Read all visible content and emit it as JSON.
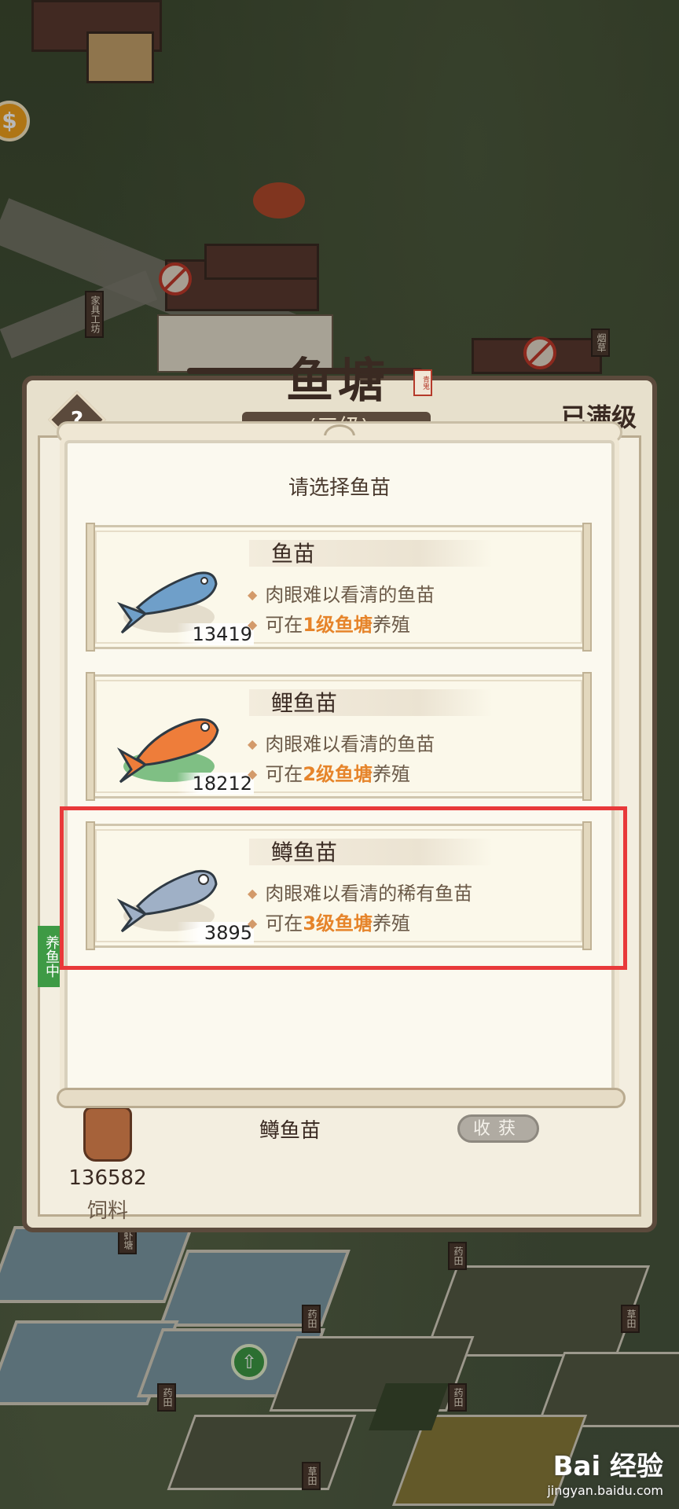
{
  "window": {
    "title": "鱼塘",
    "seal": "青鬼",
    "level_text": "(三级)",
    "maxed_label": "已满级",
    "help_icon": "?",
    "farming_tag": "养鱼中"
  },
  "background": {
    "coin_icon": "$",
    "signs": [
      "家具工坊",
      "烟草",
      "虾塘",
      "药田",
      "药田",
      "药田",
      "药田",
      "草田",
      "草田"
    ]
  },
  "popup": {
    "title": "请选择鱼苗",
    "items": [
      {
        "name": "鱼苗",
        "desc": "肉眼难以看清的鱼苗",
        "pond_prefix": "可在",
        "pond_level": "1级鱼塘",
        "pond_suffix": "养殖",
        "count": "13419",
        "fish_color": "#6f9fc9"
      },
      {
        "name": "鲤鱼苗",
        "desc": "肉眼难以看清的鱼苗",
        "pond_prefix": "可在",
        "pond_level": "2级鱼塘",
        "pond_suffix": "养殖",
        "count": "18212",
        "fish_color": "#ee7d3a"
      },
      {
        "name": "鳟鱼苗",
        "desc": "肉眼难以看清的稀有鱼苗",
        "pond_prefix": "可在",
        "pond_level": "3级鱼塘",
        "pond_suffix": "养殖",
        "count": "3895",
        "fish_color": "#9fb0c6"
      }
    ]
  },
  "bottom": {
    "feed_count": "136582",
    "feed_label": "饲料",
    "current_fish": "鳟鱼苗",
    "harvest_label": "收获"
  },
  "watermark": {
    "brand": "Bai 经验",
    "url": "jingyan.baidu.com"
  }
}
